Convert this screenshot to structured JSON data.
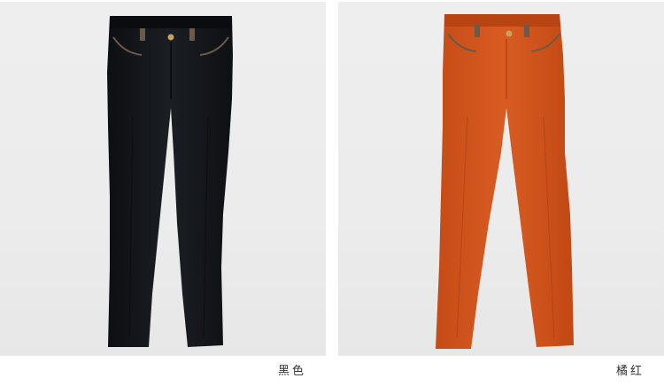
{
  "products": [
    {
      "color_name": "黑色",
      "swatch": "#15181d"
    },
    {
      "color_name": "橘红",
      "swatch": "#d2541c"
    }
  ]
}
